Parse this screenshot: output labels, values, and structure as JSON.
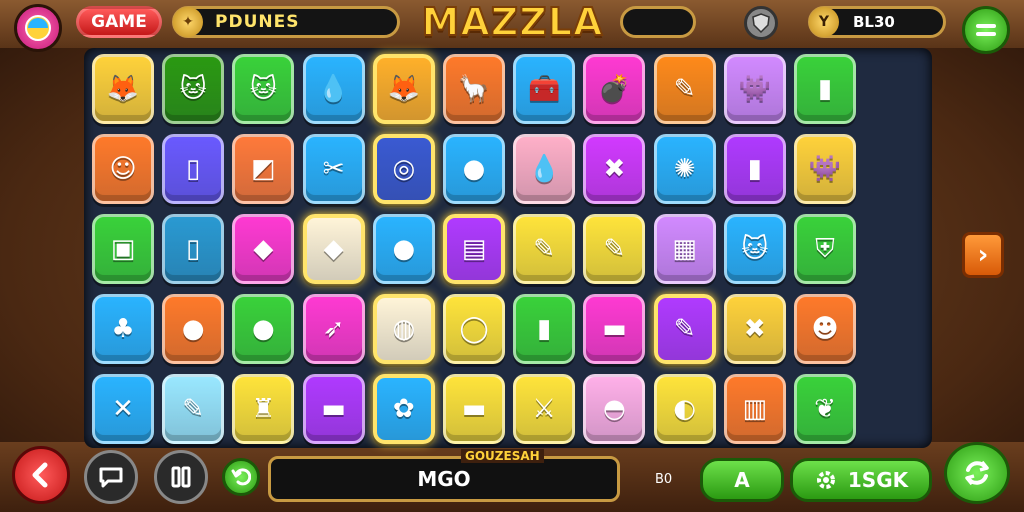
{
  "header": {
    "game_label": "GAME",
    "coins_label": "PDUNES",
    "title": "MAZZLA",
    "score_label": "BL30"
  },
  "icons": {
    "profile": "ball-icon",
    "coins": "coin-icon",
    "shield": "shield-icon",
    "score": "emblem-icon",
    "menu": "menu-icon",
    "back": "back-arrow-icon",
    "chat": "chat-icon",
    "pause": "pause-icon",
    "undo": "undo-icon",
    "settings": "gear-icon",
    "refresh": "refresh-icon",
    "next": "chevron-right-icon"
  },
  "bottom": {
    "field_caption": "GOUZESAH",
    "field_value": "MGO",
    "small_value": "B0",
    "a_button": "A",
    "settings_button": "1SGK"
  },
  "board": {
    "rows": 5,
    "cols": 11,
    "tiles": [
      [
        {
          "c": "#ffd23a",
          "g": "fox-icon"
        },
        {
          "c": "#2b9a12",
          "g": "cat-icon"
        },
        {
          "c": "#3ad23a",
          "g": "cat-icon"
        },
        {
          "c": "#2ab4ff",
          "g": "drop-icon"
        },
        {
          "c": "#ffb02a",
          "g": "fox-icon",
          "sel": true
        },
        {
          "c": "#ff7a2a",
          "g": "llama-icon"
        },
        {
          "c": "#2ab4ff",
          "g": "chest-icon"
        },
        {
          "c": "#ff3ad2",
          "g": "bomb-icon"
        },
        {
          "c": "#ff8a1a",
          "g": "pen-icon"
        },
        {
          "c": "#d28aff",
          "g": "monster-icon"
        },
        {
          "c": "#3ad23a",
          "g": "bottle-icon"
        }
      ],
      [
        {
          "c": "#ff7a2a",
          "g": "face-icon"
        },
        {
          "c": "#6a5aff",
          "g": "phone-icon"
        },
        {
          "c": "#ff7a3a",
          "g": "card-icon"
        },
        {
          "c": "#2ab4ff",
          "g": "scissors-icon"
        },
        {
          "c": "#3a5ad2",
          "g": "target-icon",
          "sel": true
        },
        {
          "c": "#2ab4ff",
          "g": "orb-icon"
        },
        {
          "c": "#ffb0c8",
          "g": "drop-icon"
        },
        {
          "c": "#d23aff",
          "g": "x-icon"
        },
        {
          "c": "#2ab4ff",
          "g": "spinner-icon"
        },
        {
          "c": "#b03aff",
          "g": "bottle-icon"
        },
        {
          "c": "#ffd23a",
          "g": "monster-icon"
        }
      ],
      [
        {
          "c": "#3ad23a",
          "g": "lantern-icon"
        },
        {
          "c": "#2a9ad2",
          "g": "phone-icon"
        },
        {
          "c": "#ff3ad2",
          "g": "gem-icon"
        },
        {
          "c": "#fff4d8",
          "g": "diamond-icon",
          "sel": true
        },
        {
          "c": "#2ab4ff",
          "g": "slime-icon"
        },
        {
          "c": "#b03aff",
          "g": "cards-icon",
          "sel": true
        },
        {
          "c": "#ffe43a",
          "g": "pen-icon"
        },
        {
          "c": "#ffe43a",
          "g": "pen-icon"
        },
        {
          "c": "#d28aff",
          "g": "box-icon"
        },
        {
          "c": "#2ab4ff",
          "g": "cat-icon"
        },
        {
          "c": "#3ad23a",
          "g": "shield-icon"
        }
      ],
      [
        {
          "c": "#2ab4ff",
          "g": "plant-icon"
        },
        {
          "c": "#ff7a2a",
          "g": "fruit-icon"
        },
        {
          "c": "#3ad23a",
          "g": "orb-icon"
        },
        {
          "c": "#ff3ad2",
          "g": "spear-icon"
        },
        {
          "c": "#fff4d8",
          "g": "globe-icon",
          "sel": true
        },
        {
          "c": "#ffe43a",
          "g": "ring-icon"
        },
        {
          "c": "#3ad23a",
          "g": "bottle-icon"
        },
        {
          "c": "#ff3ad2",
          "g": "tube-icon"
        },
        {
          "c": "#b03aff",
          "g": "pen-icon",
          "sel": true
        },
        {
          "c": "#ffd23a",
          "g": "x-icon"
        },
        {
          "c": "#ff7a2a",
          "g": "mask-icon"
        }
      ],
      [
        {
          "c": "#2ab4ff",
          "g": "tools-icon"
        },
        {
          "c": "#9ae8ff",
          "g": "pen-icon"
        },
        {
          "c": "#ffe43a",
          "g": "trophy-icon"
        },
        {
          "c": "#b03aff",
          "g": "tube-icon"
        },
        {
          "c": "#2ab4ff",
          "g": "shell-icon",
          "sel": true
        },
        {
          "c": "#ffe43a",
          "g": "bar-icon"
        },
        {
          "c": "#ffe43a",
          "g": "sword-icon"
        },
        {
          "c": "#ffb0e8",
          "g": "pot-icon"
        },
        {
          "c": "#ffe43a",
          "g": "ball-icon"
        },
        {
          "c": "#ff7a2a",
          "g": "crate-icon"
        },
        {
          "c": "#3ad23a",
          "g": "leaf-icon"
        }
      ]
    ]
  }
}
